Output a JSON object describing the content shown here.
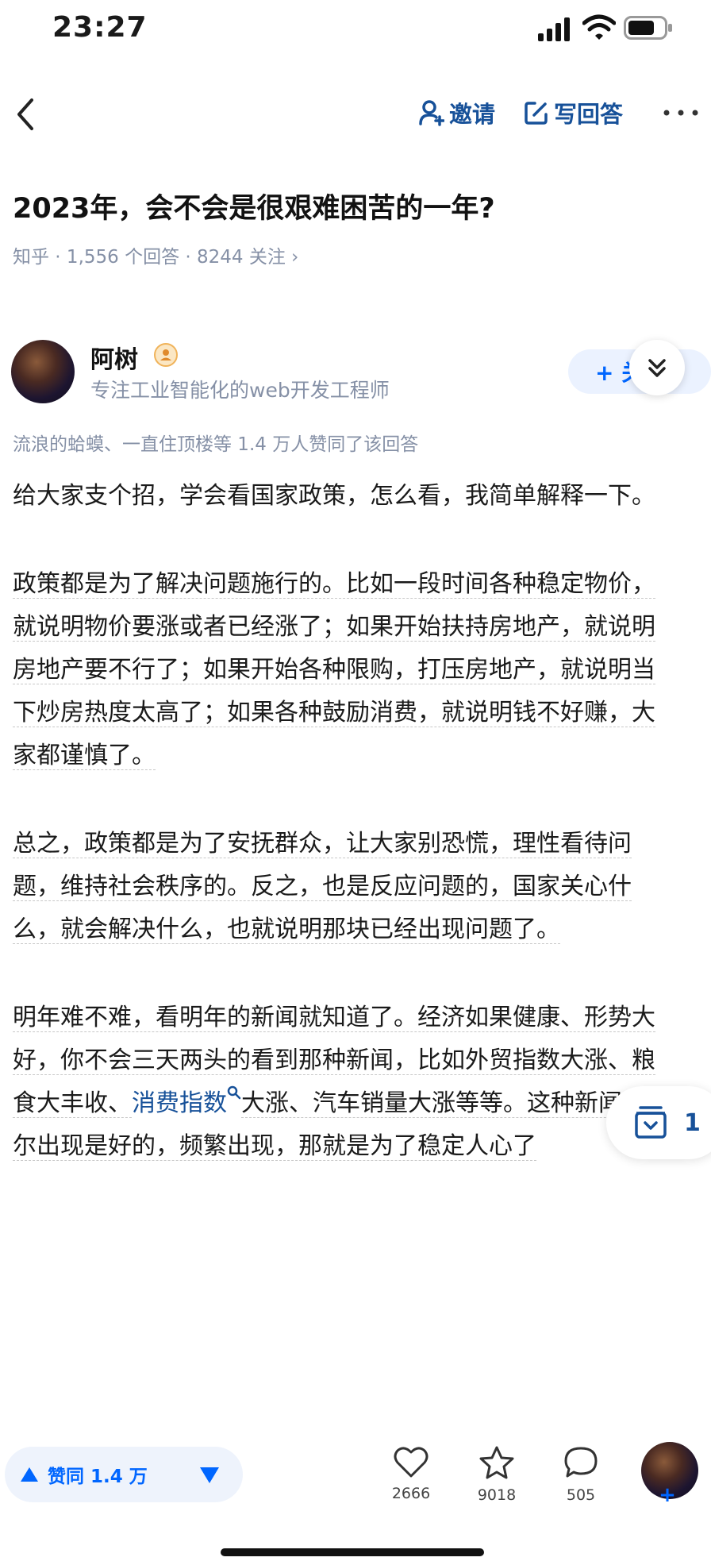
{
  "status_bar": {
    "time": "23:27"
  },
  "nav": {
    "invite_label": "邀请",
    "write_answer_label": "写回答"
  },
  "question": {
    "title": "2023年，会不会是很艰难困苦的一年?",
    "meta": "知乎 · 1,556 个回答 · 8244 关注 ›"
  },
  "author": {
    "name": "阿树",
    "bio": "专注工业智能化的web开发工程师",
    "follow_label": "+ 关"
  },
  "endorsements": "流浪的蛤蟆、一直住顶楼等 1.4 万人赞同了该回答",
  "answer": {
    "p1": "给大家支个招，学会看国家政策，怎么看，我简单解释一下。",
    "p2": "政策都是为了解决问题施行的。比如一段时间各种稳定物价，就说明物价要涨或者已经涨了；如果开始扶持房地产，就说明房地产要不行了；如果开始各种限购，打压房地产，就说明当下炒房热度太高了；如果各种鼓励消费，就说明钱不好赚，大家都谨慎了。",
    "p3": "总之，政策都是为了安抚群众，让大家别恐慌，理性看待问题，维持社会秩序的。反之，也是反应问题的，国家关心什么，就会解决什么，也就说明那块已经出现问题了。",
    "p4_before": "明年难不难，看明年的新闻就知道了。经济如果健康、形势大好，你不会三天两头的看到那种新闻，比如外贸指数大涨、粮食大丰收、",
    "p4_link": "消费指数",
    "p4_after": "大涨、汽车销量大涨等等。这种新闻偶尔出现是好的，频繁出现，那就是为了稳定人心了"
  },
  "collect_float": {
    "count": "1"
  },
  "bottom_bar": {
    "vote_up_label": "赞同 1.4 万",
    "like_count": "2666",
    "star_count": "9018",
    "comment_count": "505",
    "plus": "+"
  },
  "colors": {
    "link": "#175199",
    "brand": "#0066ff",
    "muted": "#8590a6"
  }
}
